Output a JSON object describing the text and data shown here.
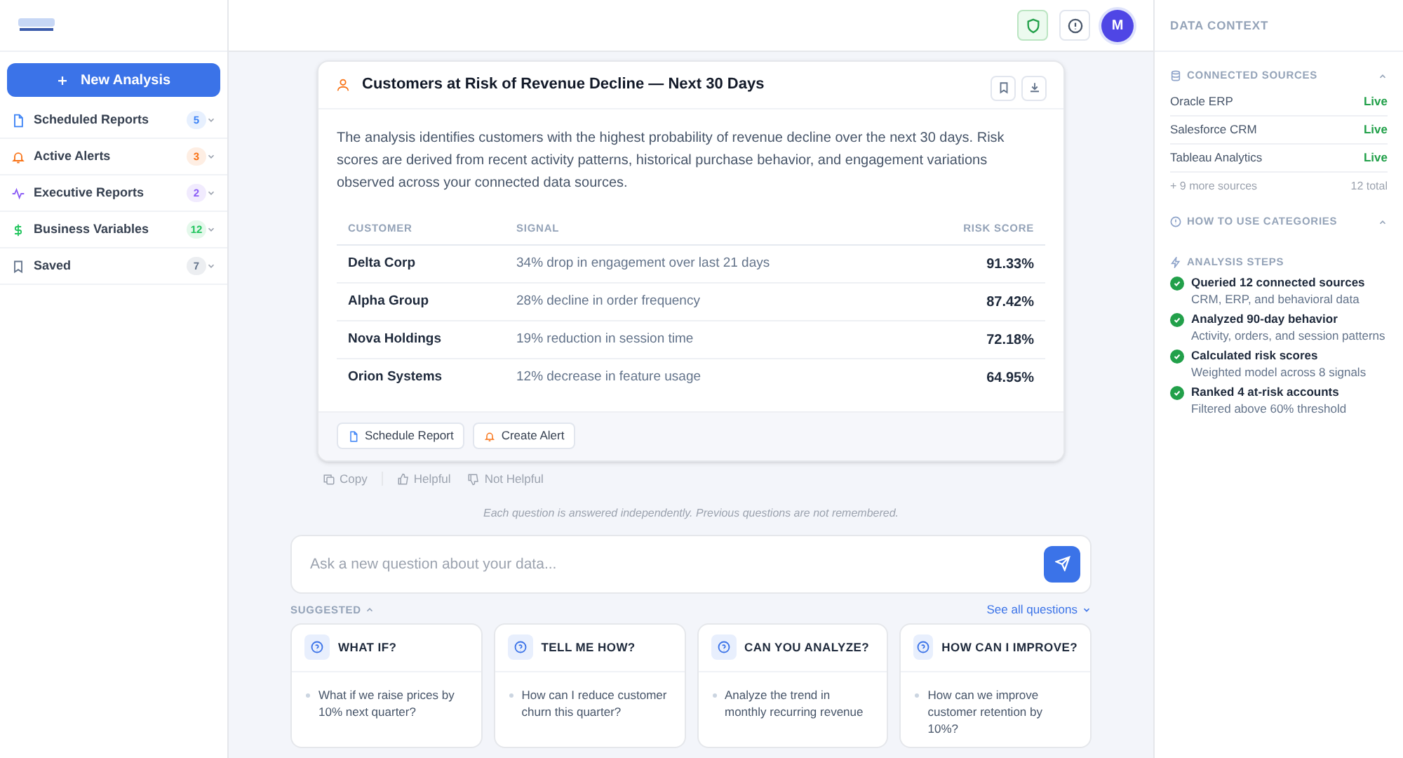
{
  "sidebar": {
    "new_button": "New Analysis",
    "items": [
      {
        "kind": "report",
        "label": "Scheduled Reports",
        "count": "5",
        "color": "#3b82f6"
      },
      {
        "kind": "alert",
        "label": "Active Alerts",
        "count": "3",
        "color": "#f97316"
      },
      {
        "kind": "pulse",
        "label": "Executive Reports",
        "count": "2",
        "color": "#8b5cf6"
      },
      {
        "kind": "dollar",
        "label": "Business Variables",
        "count": "12",
        "color": "#22c55e"
      },
      {
        "kind": "bookmark",
        "label": "Saved",
        "count": "7",
        "color": "#64748b"
      }
    ]
  },
  "header": {
    "avatar": "M"
  },
  "result": {
    "title": "Customers at Risk of Revenue Decline — Next 30 Days",
    "summary": "The analysis identifies customers with the highest probability of revenue decline over the next 30 days. Risk scores are derived from recent activity patterns, historical purchase behavior, and engagement variations observed across your connected data sources.",
    "columns": [
      "CUSTOMER",
      "SIGNAL",
      "RISK SCORE"
    ],
    "rows": [
      [
        "Delta Corp",
        "34% drop in engagement over last 21 days",
        "91.33%"
      ],
      [
        "Alpha Group",
        "28% decline in order frequency",
        "87.42%"
      ],
      [
        "Nova Holdings",
        "19% reduction in session time",
        "72.18%"
      ],
      [
        "Orion Systems",
        "12% decrease in feature usage",
        "64.95%"
      ]
    ],
    "actions": [
      {
        "kind": "report",
        "label": "Schedule Report"
      },
      {
        "kind": "alert",
        "label": "Create Alert"
      }
    ]
  },
  "feedback": [
    "Copy",
    "Helpful",
    "Not Helpful"
  ],
  "note": "Each question is answered independently. Previous questions are not remembered.",
  "ask": {
    "placeholder": "Ask a new question about your data..."
  },
  "suggested": {
    "label": "SUGGESTED",
    "see_all": "See all questions",
    "cards": [
      {
        "title": "WHAT IF?",
        "question": "What if we raise prices by 10% next quarter?"
      },
      {
        "title": "TELL ME HOW?",
        "question": "How can I reduce customer churn this quarter?"
      },
      {
        "title": "CAN YOU ANALYZE?",
        "question": "Analyze the trend in monthly recurring revenue"
      },
      {
        "title": "HOW CAN I IMPROVE?",
        "question": "How can we improve customer retention by 10%?"
      }
    ]
  },
  "context": {
    "title": "DATA CONTEXT",
    "sources_title": "CONNECTED SOURCES",
    "sources": [
      {
        "name": "Oracle ERP",
        "status": "Live"
      },
      {
        "name": "Salesforce CRM",
        "status": "Live"
      },
      {
        "name": "Tableau Analytics",
        "status": "Live"
      }
    ],
    "more": "+ 9 more sources",
    "total": "12 total",
    "howto": "HOW TO USE CATEGORIES",
    "steps_title": "ANALYSIS STEPS",
    "steps": [
      {
        "title": "Queried 12 connected sources",
        "detail": "CRM, ERP, and behavioral data",
        "done": true
      },
      {
        "title": "Analyzed 90-day behavior",
        "detail": "Activity, orders, and session patterns",
        "done": true
      },
      {
        "title": "Calculated risk scores",
        "detail": "Weighted model across 8 signals",
        "done": true
      },
      {
        "title": "Ranked 4 at-risk accounts",
        "detail": "Filtered above 60% threshold",
        "done": true
      }
    ]
  }
}
